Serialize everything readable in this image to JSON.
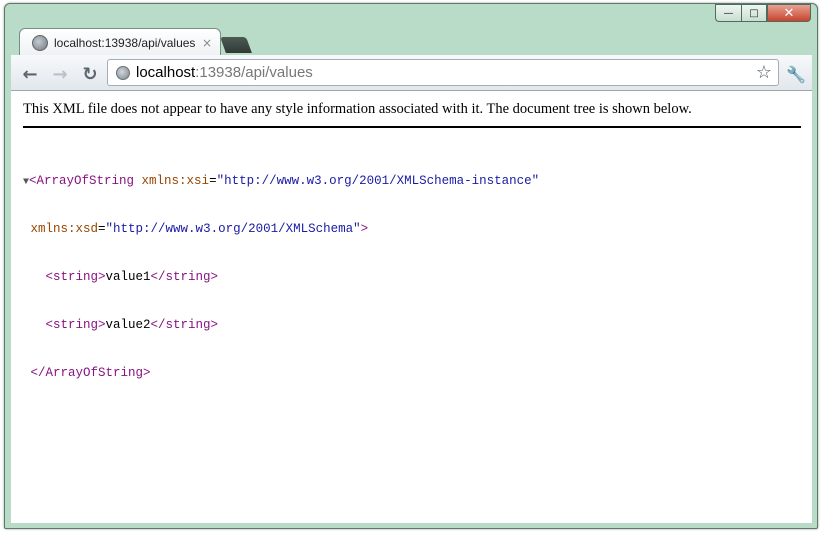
{
  "window": {
    "controls": {
      "minimize": "—",
      "maximize": "□",
      "close": "✕"
    }
  },
  "tab": {
    "title": "localhost:13938/api/values",
    "close_symbol": "×"
  },
  "toolbar": {
    "back_symbol": "←",
    "forward_symbol": "→",
    "reload_symbol": "↻",
    "url_host": "localhost",
    "url_rest": ":13938/api/values",
    "star_symbol": "☆",
    "wrench_symbol": "🔧"
  },
  "document": {
    "notice": "This XML file does not appear to have any style information associated with it. The document tree is shown below.",
    "toggle": "▼",
    "root_open": "<ArrayOfString",
    "xsi_attr": " xmlns:xsi",
    "eq": "=",
    "xsi_val": "\"http://www.w3.org/2001/XMLSchema-instance\"",
    "xsd_attr": "xmlns:xsd",
    "xsd_val": "\"http://www.w3.org/2001/XMLSchema\"",
    "root_open_end": ">",
    "items": [
      {
        "open": "<string>",
        "value": "value1",
        "close": "</string>"
      },
      {
        "open": "<string>",
        "value": "value2",
        "close": "</string>"
      }
    ],
    "root_close": "</ArrayOfString>"
  },
  "icons": [
    "globe-icon",
    "back-icon",
    "forward-icon",
    "reload-icon",
    "star-icon",
    "wrench-icon",
    "minimize-icon",
    "maximize-icon",
    "close-icon"
  ]
}
